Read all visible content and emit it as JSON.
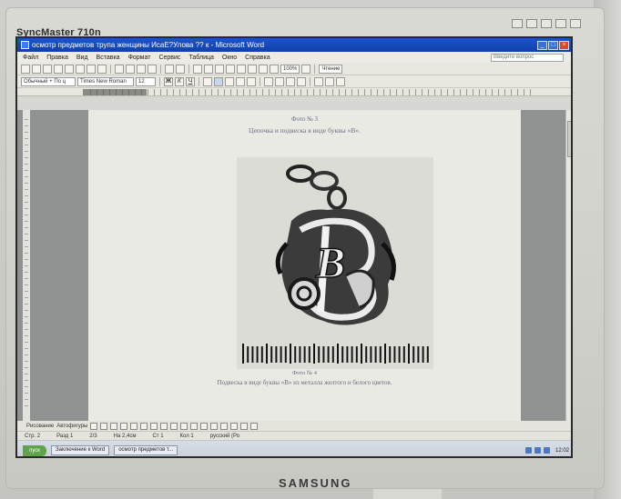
{
  "monitor": {
    "model_label": "SyncMaster 710n",
    "brand": "SAMSUNG"
  },
  "window": {
    "title": "осмотр предметов трупа женщины ИсаЕ?Улова ?? к - Microsoft Word",
    "close_glyph": "×",
    "min_glyph": "_",
    "max_glyph": "□"
  },
  "menu": {
    "items": [
      "Файл",
      "Правка",
      "Вид",
      "Вставка",
      "Формат",
      "Сервис",
      "Таблица",
      "Окно",
      "Справка"
    ],
    "help_placeholder": "Введите вопрос"
  },
  "toolbar1": {
    "zoom": "100%",
    "read_label": "Чтение"
  },
  "toolbar2": {
    "style": "Обычный + По ц",
    "font": "Times New Roman",
    "size": "12",
    "bold": "Ж",
    "italic": "К",
    "underline": "Ч"
  },
  "document": {
    "caption_top_number": "Фото № 3",
    "caption_top_text": "Цепочка и подвеска в виде буквы «В».",
    "caption_bottom_number": "Фото № 4",
    "caption_bottom_text": "Подвеска в виде буквы «В» из металла желтого и белого цветов.",
    "pendant_letter": "В"
  },
  "drawing_bar": {
    "draw_label": "Рисование",
    "autoshapes_label": "Автофигуры"
  },
  "statusbar": {
    "page": "Стр. 2",
    "section": "Разд 1",
    "pages": "2/3",
    "position": "На 2,4см",
    "line": "Ст 1",
    "col": "Кол 1",
    "lang": "русский (Ро"
  },
  "taskbar": {
    "start_label": "пуск",
    "tasks": [
      "Заключение к Word",
      "осмотр предметов т..."
    ],
    "clock": "12:02"
  }
}
